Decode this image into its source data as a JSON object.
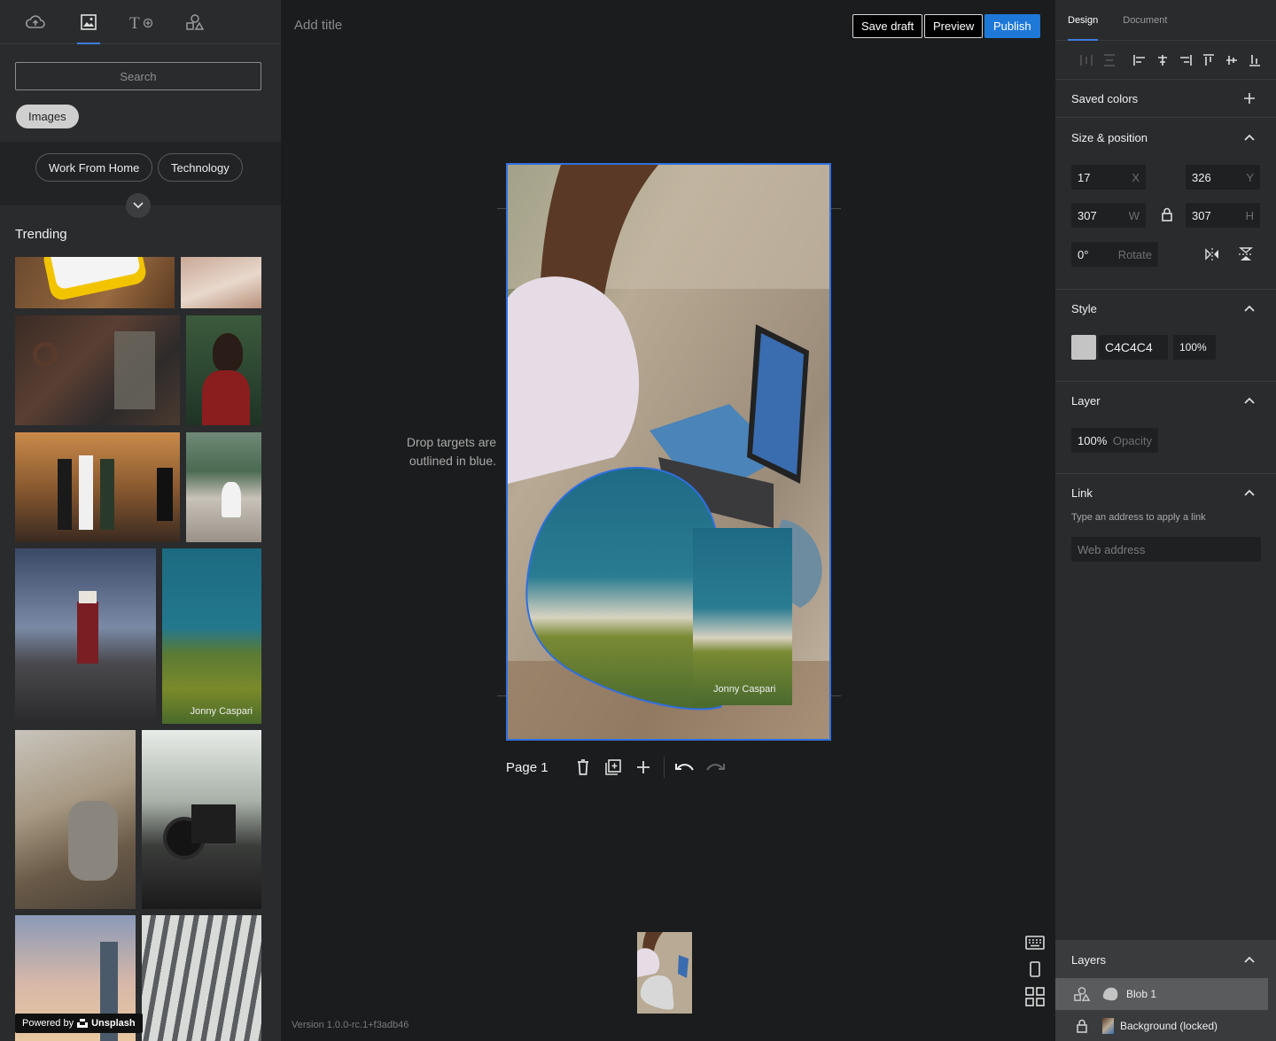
{
  "library": {
    "tabs": [
      {
        "name": "upload",
        "icon": "cloud-upload-icon"
      },
      {
        "name": "media",
        "icon": "image-icon",
        "active": true
      },
      {
        "name": "text",
        "icon": "text-icon"
      },
      {
        "name": "shapes",
        "icon": "shapes-icon"
      }
    ],
    "search_placeholder": "Search",
    "filter_chip": "Images",
    "categories": [
      "Work From Home",
      "Technology"
    ],
    "trending_label": "Trending",
    "credits": {
      "jonny": "Jonny Caspari"
    },
    "powered_by": "Powered by",
    "provider": "Unsplash"
  },
  "editor": {
    "title_placeholder": "Add title",
    "save_draft": "Save draft",
    "preview": "Preview",
    "publish": "Publish",
    "drop_hint": "Drop targets are outlined in blue.",
    "image_credit": "Jonny Caspari",
    "page_label": "Page 1",
    "version": "Version 1.0.0-rc.1+f3adb46"
  },
  "inspector": {
    "tabs": [
      "Design",
      "Document"
    ],
    "saved_colors": "Saved colors",
    "size_position": "Size & position",
    "x": {
      "value": "17",
      "suffix": "X"
    },
    "y": {
      "value": "326",
      "suffix": "Y"
    },
    "w": {
      "value": "307",
      "suffix": "W"
    },
    "h": {
      "value": "307",
      "suffix": "H"
    },
    "rotate": {
      "value": "0°",
      "suffix": "Rotate"
    },
    "style": "Style",
    "color_hex": "C4C4C4",
    "color_opacity": "100%",
    "layer": "Layer",
    "layer_opacity": {
      "value": "100%",
      "suffix": "Opacity"
    },
    "link": "Link",
    "link_hint": "Type an address to apply a link",
    "link_placeholder": "Web address",
    "layers": "Layers",
    "layer_items": [
      "Blob 1",
      "Background (locked)"
    ]
  },
  "colors": {
    "accent": "#1e78d8",
    "selection": "#2f6fe0",
    "swatch": "#c4c4c4"
  }
}
